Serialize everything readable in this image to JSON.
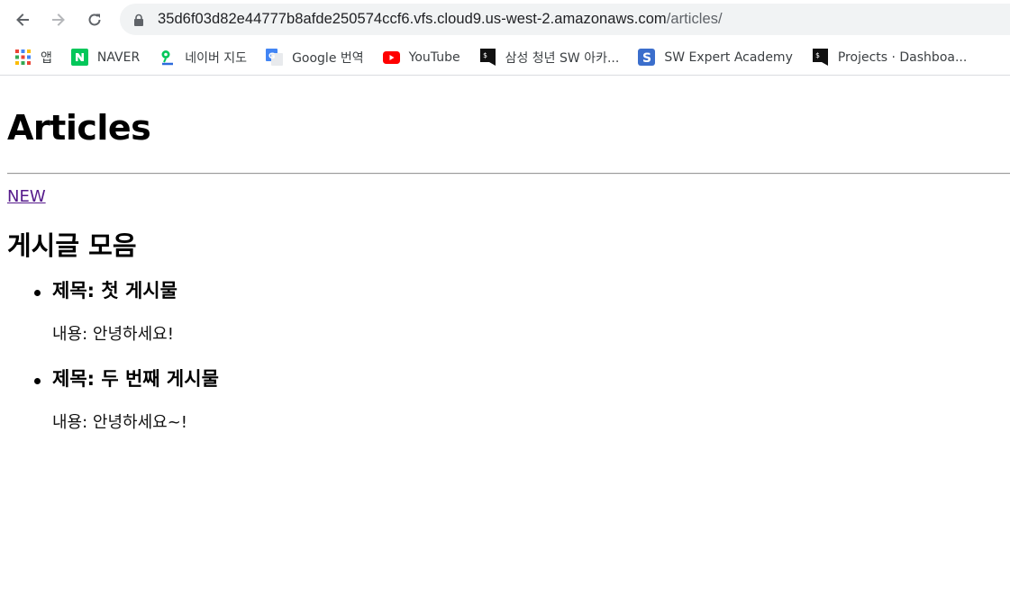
{
  "browser": {
    "url_host": "35d6f03d82e44777b8afde250574ccf6.vfs.cloud9.us-west-2.amazonaws.com",
    "url_path": "/articles/"
  },
  "bookmarks": [
    {
      "label": "앱",
      "icon": "apps-grid-icon"
    },
    {
      "label": "NAVER",
      "icon": "naver-icon",
      "color": "#03c75a"
    },
    {
      "label": "네이버 지도",
      "icon": "naver-map-icon"
    },
    {
      "label": "Google 번역",
      "icon": "google-translate-icon"
    },
    {
      "label": "YouTube",
      "icon": "youtube-icon",
      "color": "#ff0000"
    },
    {
      "label": "삼성 청년 SW 아카...",
      "icon": "terminal-icon"
    },
    {
      "label": "SW Expert Academy",
      "icon": "sw-expert-icon",
      "color": "#3b6ecc"
    },
    {
      "label": "Projects · Dashboa...",
      "icon": "terminal-icon"
    }
  ],
  "page": {
    "title": "Articles",
    "new_link": "NEW",
    "section_title": "게시글 모음",
    "articles": [
      {
        "title": "제목: 첫 게시물",
        "content": "내용: 안녕하세요!"
      },
      {
        "title": "제목: 두 번째 게시물",
        "content": "내용: 안녕하세요~!"
      }
    ]
  },
  "colors": {
    "link_visited": "#551a8b",
    "omnibox_bg": "#f1f3f4"
  }
}
